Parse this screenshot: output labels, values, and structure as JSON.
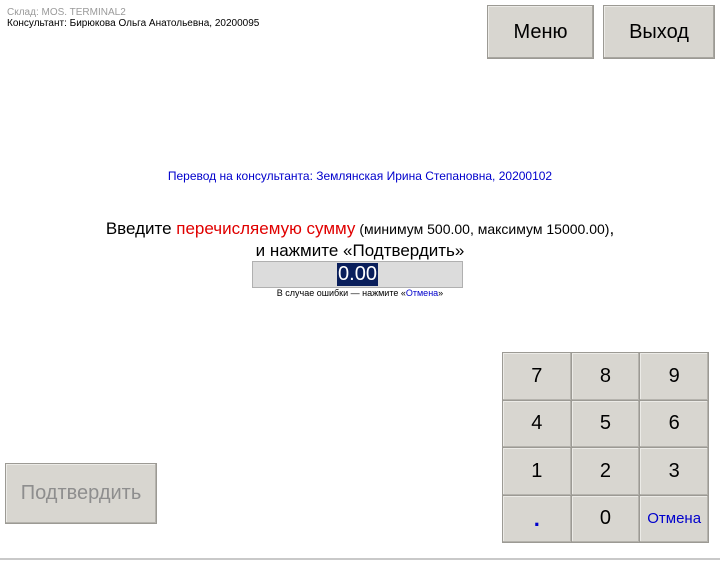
{
  "header": {
    "warehouse": "Склад: MOS. TERMINAL2",
    "consultant": "Консультант: Бирюкова Ольга Анатольевна, 20200095"
  },
  "buttons": {
    "menu": "Меню",
    "exit": "Выход",
    "confirm": "Подтвердить"
  },
  "transfer_info": "Перевод на консультанта: Землянская Ирина Степановна, 20200102",
  "instruction": {
    "prefix": "Введите ",
    "highlight": "перечисляемую сумму",
    "range": " (минимум 500.00, максимум 15000.00)",
    "suffix": ",",
    "line2": "и нажмите «Подтвердить»"
  },
  "amount": {
    "value": "0.00"
  },
  "hint": {
    "prefix": "В случае ошибки — нажмите «",
    "link": "Отмена",
    "suffix": "»"
  },
  "keypad": {
    "k7": "7",
    "k8": "8",
    "k9": "9",
    "k4": "4",
    "k5": "5",
    "k6": "6",
    "k1": "1",
    "k2": "2",
    "k3": "3",
    "dot": ".",
    "k0": "0",
    "cancel": "Отмена"
  },
  "colors": {
    "accent_blue": "#0000cc",
    "highlight_red": "#e00000",
    "button_bg": "#d8d6d0",
    "selection_bg": "#0a1f5c"
  }
}
